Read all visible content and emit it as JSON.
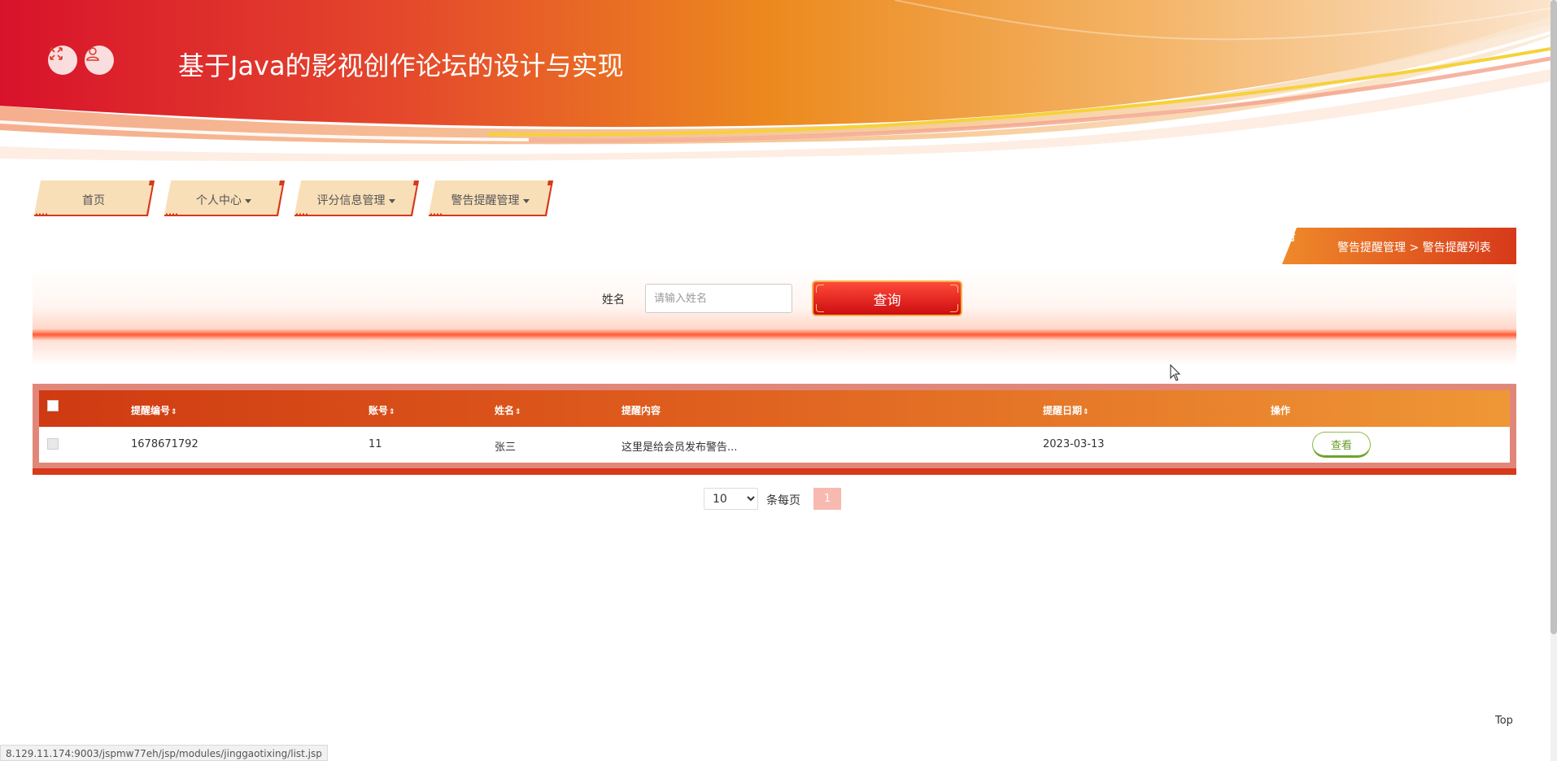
{
  "header": {
    "title": "基于Java的影视创作论坛的设计与实现",
    "buttons": [
      {
        "icon": "expand-icon"
      },
      {
        "icon": "user-icon"
      }
    ]
  },
  "nav": {
    "items": [
      {
        "label": "首页",
        "dropdown": false
      },
      {
        "label": "个人中心",
        "dropdown": true
      },
      {
        "label": "评分信息管理",
        "dropdown": true
      },
      {
        "label": "警告提醒管理",
        "dropdown": true
      }
    ]
  },
  "breadcrumb": {
    "icon": "home-icon",
    "parent": "警告提醒管理",
    "separator": ">",
    "current": "警告提醒列表"
  },
  "search": {
    "label": "姓名",
    "placeholder": "请输入姓名",
    "value": "",
    "button_label": "查询"
  },
  "table": {
    "columns": [
      "提醒编号",
      "账号",
      "姓名",
      "提醒内容",
      "提醒日期",
      "操作"
    ],
    "sortable": [
      true,
      true,
      true,
      false,
      true,
      false
    ],
    "sort_glyph": "⇕",
    "rows": [
      {
        "id": "1678671792",
        "account": "11",
        "name": "张三",
        "content": "这里是给会员发布警告...",
        "date": "2023-03-13",
        "action_label": "查看"
      }
    ]
  },
  "pagination": {
    "page_size": "10",
    "page_size_options": [
      "10"
    ],
    "per_page_label": "条每页",
    "current_page": "1"
  },
  "footer": {
    "top_label": "Top",
    "status_url": "8.129.11.174:9003/jspmw77eh/jsp/modules/jinggaotixing/list.jsp"
  },
  "colors": {
    "primary_red": "#d7391a",
    "accent_orange": "#ef9736",
    "nav_bg": "#f8dfb8",
    "view_green": "#6a9b2a"
  }
}
